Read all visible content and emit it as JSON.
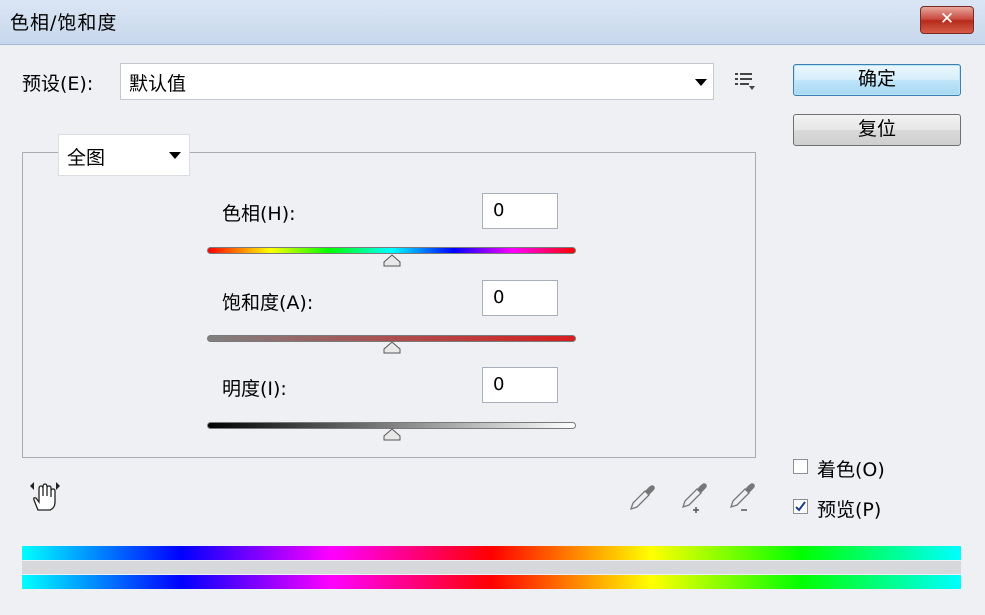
{
  "window": {
    "title": "色相/饱和度",
    "close_label": "✕"
  },
  "preset": {
    "label": "预设(E):",
    "value": "默认值",
    "menu_icon": "preset-options-icon"
  },
  "buttons": {
    "ok": "确定",
    "reset": "复位"
  },
  "channel": {
    "value": "全图"
  },
  "adjustments": [
    {
      "label": "色相(H):",
      "value": "0",
      "position": 0.5,
      "track": "hue-gradient"
    },
    {
      "label": "饱和度(A):",
      "value": "0",
      "position": 0.5,
      "track": "saturation-gradient"
    },
    {
      "label": "明度(I):",
      "value": "0",
      "position": 0.5,
      "track": "lightness-gradient"
    }
  ],
  "options": {
    "colorize": {
      "label": "着色(O)",
      "checked": false
    },
    "preview": {
      "label": "预览(P)",
      "checked": true
    }
  },
  "tools": [
    "targeted-adjust-hand-icon",
    "eyedropper-icon",
    "eyedropper-plus-icon",
    "eyedropper-minus-icon"
  ],
  "colors": {
    "ok_button": "#bfe5fa",
    "close_button": "#c8473a",
    "checkbox_check": "#1a3e8c"
  }
}
